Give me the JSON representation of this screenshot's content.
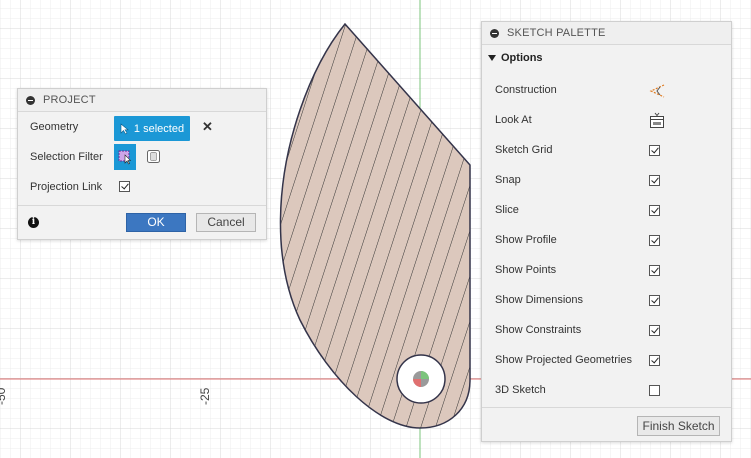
{
  "project": {
    "title": "PROJECT",
    "geometry_label": "Geometry",
    "geometry_value": "1 selected",
    "selection_filter_label": "Selection Filter",
    "projection_link_label": "Projection Link",
    "projection_link_checked": true,
    "ok_label": "OK",
    "cancel_label": "Cancel"
  },
  "palette": {
    "title": "SKETCH PALETTE",
    "options_label": "Options",
    "items": [
      {
        "label": "Construction",
        "control": "construction-icon"
      },
      {
        "label": "Look At",
        "control": "look-at-icon"
      },
      {
        "label": "Sketch Grid",
        "control": "checkbox",
        "checked": true
      },
      {
        "label": "Snap",
        "control": "checkbox",
        "checked": true
      },
      {
        "label": "Slice",
        "control": "checkbox",
        "checked": true
      },
      {
        "label": "Show Profile",
        "control": "checkbox",
        "checked": true
      },
      {
        "label": "Show Points",
        "control": "checkbox",
        "checked": true
      },
      {
        "label": "Show Dimensions",
        "control": "checkbox",
        "checked": true
      },
      {
        "label": "Show Constraints",
        "control": "checkbox",
        "checked": true
      },
      {
        "label": "Show Projected Geometries",
        "control": "checkbox",
        "checked": true
      },
      {
        "label": "3D Sketch",
        "control": "checkbox",
        "checked": false
      }
    ],
    "finish_label": "Finish Sketch"
  },
  "canvas": {
    "axis_labels": [
      "-25",
      "-50"
    ],
    "colors": {
      "profile_fill": "#dcc8bd",
      "selection_blue": "#1b98d6",
      "ok_blue": "#3c77c1",
      "x_axis": "#e07070",
      "y_axis": "#7cc47c"
    }
  }
}
